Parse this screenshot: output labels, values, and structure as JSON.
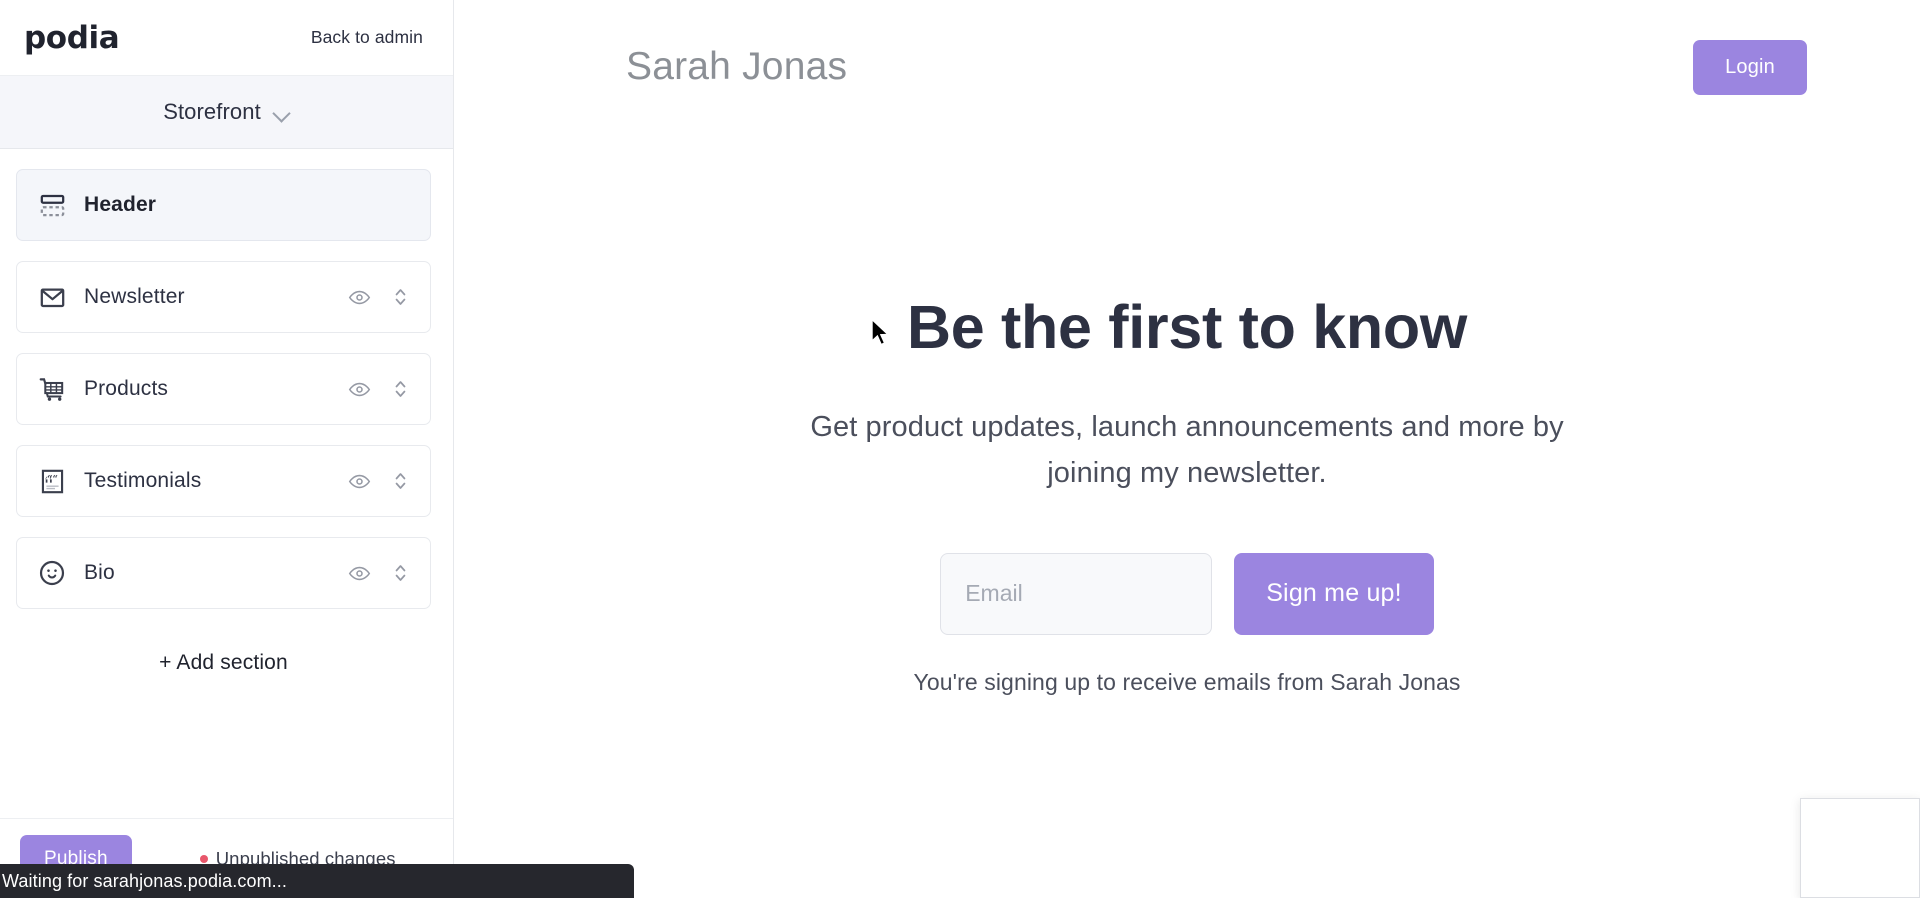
{
  "sidebar": {
    "logo_text": "podia",
    "back_link": "Back to admin",
    "selector_label": "Storefront",
    "sections": [
      {
        "label": "Header",
        "icon": "header-layout-icon",
        "active": true,
        "has_visibility_toggle": false,
        "has_reorder": false
      },
      {
        "label": "Newsletter",
        "icon": "envelope-icon",
        "active": false,
        "has_visibility_toggle": true,
        "has_reorder": true
      },
      {
        "label": "Products",
        "icon": "shopping-cart-icon",
        "active": false,
        "has_visibility_toggle": true,
        "has_reorder": true
      },
      {
        "label": "Testimonials",
        "icon": "quote-icon",
        "active": false,
        "has_visibility_toggle": true,
        "has_reorder": true
      },
      {
        "label": "Bio",
        "icon": "smiley-face-icon",
        "active": false,
        "has_visibility_toggle": true,
        "has_reorder": true
      }
    ],
    "add_section_label": "+ Add section",
    "publish_label": "Publish",
    "unpublished_status": "Unpublished changes"
  },
  "preview": {
    "store_name": "Sarah Jonas",
    "login_label": "Login",
    "hero_title": "Be the first to know",
    "hero_subtitle": "Get product updates, launch announcements and more by joining my newsletter.",
    "email_placeholder": "Email",
    "email_value": "",
    "signup_label": "Sign me up!",
    "disclaimer": "You're signing up to receive emails from Sarah Jonas"
  },
  "browser": {
    "status_text": "Waiting for sarahjonas.podia.com..."
  },
  "colors": {
    "accent_purple": "#9b85e0",
    "status_red": "#e8576b",
    "text_dark": "#2d3142",
    "text_muted": "#8c9096"
  }
}
